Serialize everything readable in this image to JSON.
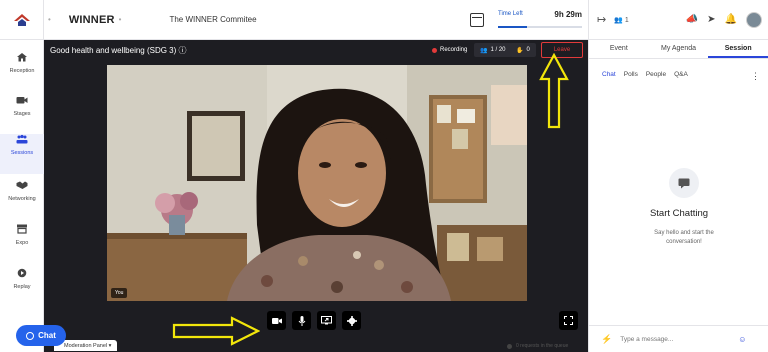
{
  "header": {
    "brand": "WINNER",
    "event_name": "The WINNER Commitee",
    "time_left_label": "Time Left",
    "time_left_value": "9h 29m",
    "time_left_fraction": 0.35
  },
  "right_header": {
    "attendee_count": "1"
  },
  "nav": {
    "items": [
      {
        "label": "Reception",
        "icon": "home-icon"
      },
      {
        "label": "Stages",
        "icon": "video-camera-icon"
      },
      {
        "label": "Sessions",
        "icon": "people-icon"
      },
      {
        "label": "Networking",
        "icon": "handshake-icon"
      },
      {
        "label": "Expo",
        "icon": "booth-icon"
      },
      {
        "label": "Replay",
        "icon": "replay-icon"
      }
    ],
    "active": "Sessions"
  },
  "session": {
    "title": "Good health and wellbeing (SDG 3) ⓘ",
    "recording_label": "Recording",
    "participants": "1 / 20",
    "queue_count": "0",
    "leave_label": "Leave",
    "video_label": "You",
    "moderation_panel": "Moderation Panel ▾",
    "queue_status": "0 requests in the queue"
  },
  "chat_fab": {
    "label": "Chat"
  },
  "right_panel": {
    "tabs": [
      "Event",
      "My Agenda",
      "Session"
    ],
    "active_tab": "Session",
    "subtabs": [
      "Chat",
      "Polls",
      "People",
      "Q&A"
    ],
    "active_subtab": "Chat",
    "empty_title": "Start Chatting",
    "empty_subtitle": "Say hello and start the conversation!",
    "message_placeholder": "Type a message..."
  },
  "colors": {
    "accent": "#2b46d9",
    "stage_bg": "#1d1d22",
    "leave": "#e23a3a",
    "annotation_arrow": "#f2e60b"
  }
}
